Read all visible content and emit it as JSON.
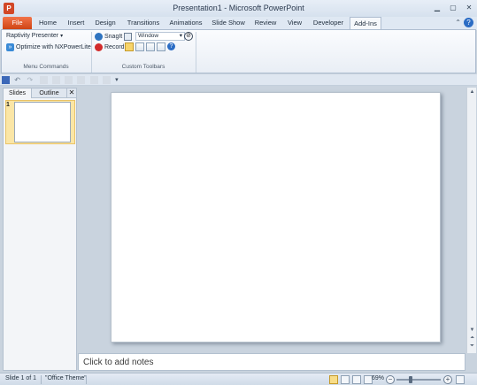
{
  "window": {
    "title": "Presentation1 - Microsoft PowerPoint",
    "app_icon_letter": "P"
  },
  "tabs": [
    {
      "label": "File"
    },
    {
      "label": "Home"
    },
    {
      "label": "Insert"
    },
    {
      "label": "Design"
    },
    {
      "label": "Transitions"
    },
    {
      "label": "Animations"
    },
    {
      "label": "Slide Show"
    },
    {
      "label": "Review"
    },
    {
      "label": "View"
    },
    {
      "label": "Developer"
    },
    {
      "label": "Add-Ins"
    }
  ],
  "ribbon": {
    "menu_commands": {
      "group_label": "Menu Commands",
      "raptivity": "Raptivity Presenter",
      "optimize": "Optimize with NXPowerLite"
    },
    "custom_toolbars": {
      "group_label": "Custom Toolbars",
      "snagit": "SnagIt",
      "window_value": "Window",
      "record": "Record"
    }
  },
  "slides_pane": {
    "tab_slides": "Slides",
    "tab_outline": "Outline",
    "close_glyph": "✕",
    "slide_number": "1"
  },
  "notes": {
    "placeholder": "Click to add notes"
  },
  "status": {
    "slide_info": "Slide 1 of 1",
    "theme": "\"Office Theme\"",
    "zoom": "69%"
  },
  "colors": {
    "file_tab": "#d24726",
    "accent": "#2b579a",
    "selected_thumb": "#fbe6a6"
  }
}
